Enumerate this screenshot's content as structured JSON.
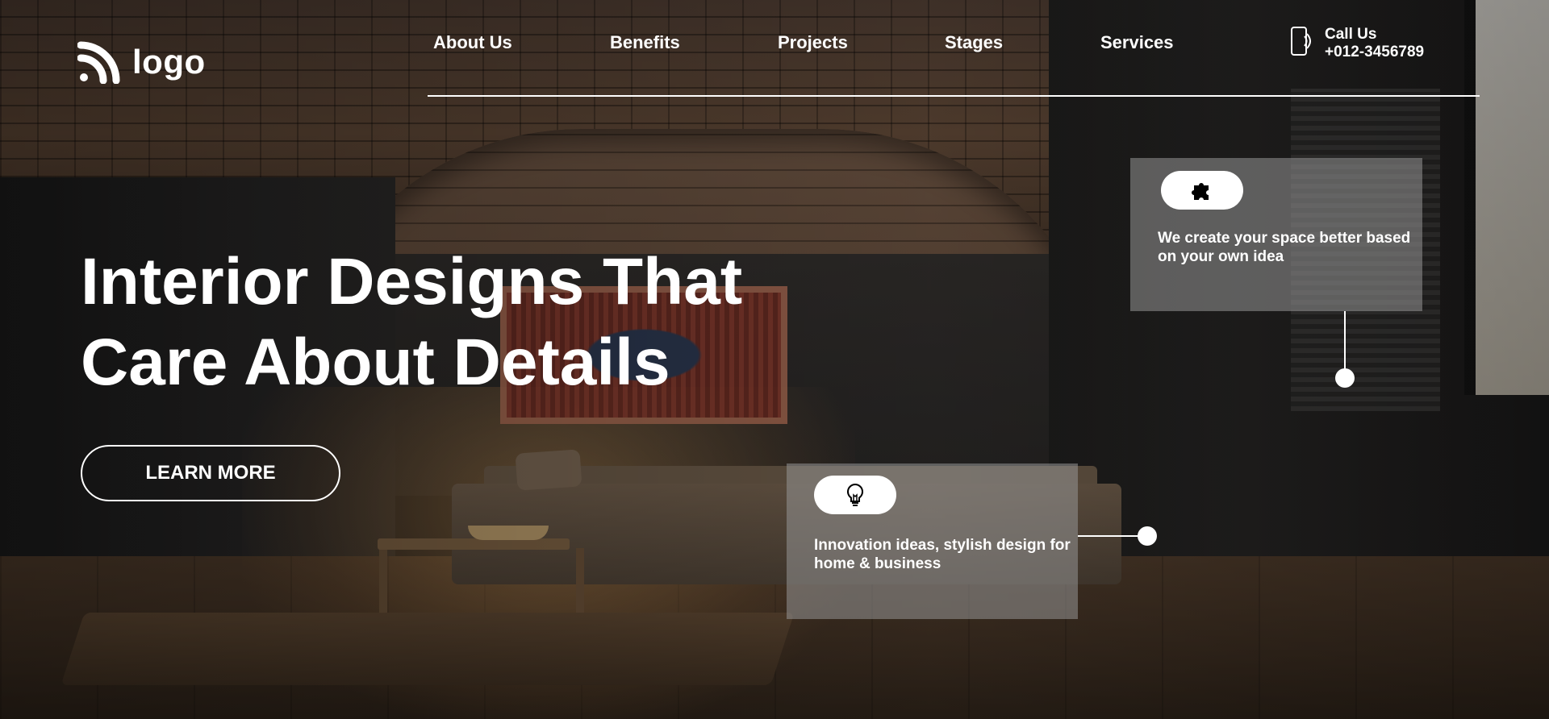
{
  "logo": {
    "text": "logo",
    "icon": "wifi-icon"
  },
  "nav": {
    "items": [
      {
        "label": "About Us"
      },
      {
        "label": "Benefits"
      },
      {
        "label": "Projects"
      },
      {
        "label": "Stages"
      },
      {
        "label": "Services"
      }
    ]
  },
  "contact": {
    "label": "Call Us",
    "phone": "+012-3456789",
    "icon": "phone-icon"
  },
  "hero": {
    "title_line1": "Interior Designs That",
    "title_line2": "Care About Details",
    "button_label": "LEARN MORE"
  },
  "features": [
    {
      "icon": "puzzle-icon",
      "text": "We create your space better based on your own idea"
    },
    {
      "icon": "lightbulb-icon",
      "text": "Innovation ideas, stylish design for home & business"
    }
  ]
}
